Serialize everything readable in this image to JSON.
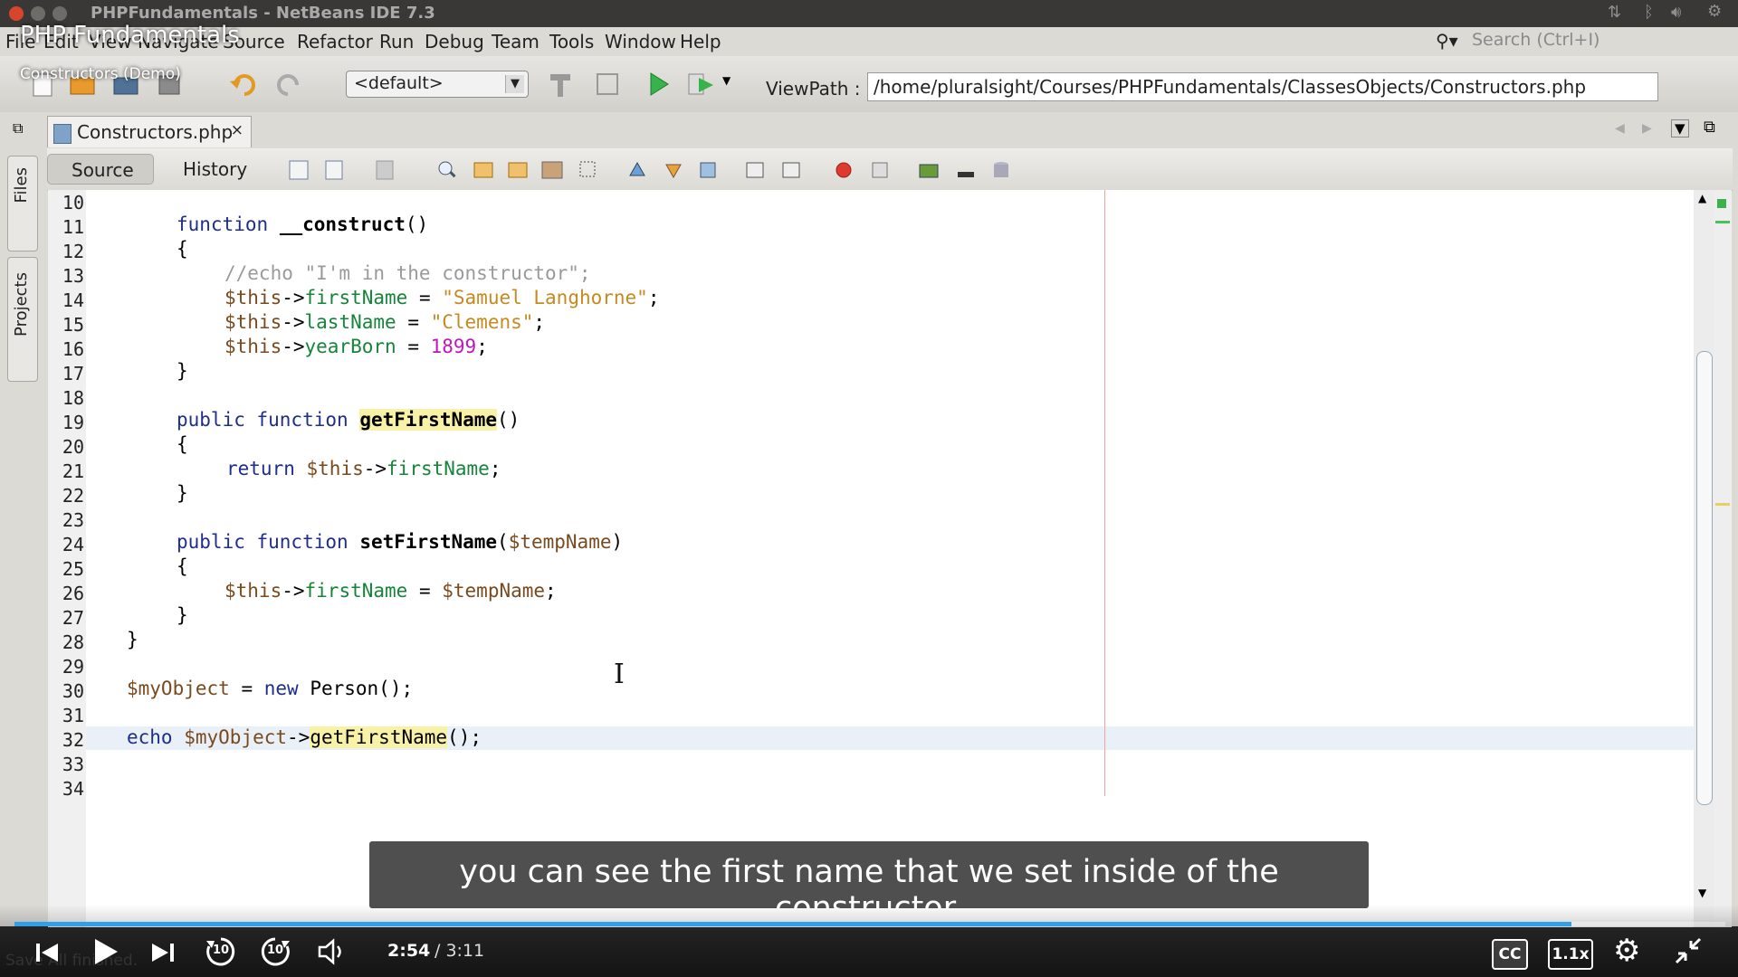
{
  "window": {
    "title": "PHPFundamentals - NetBeans IDE 7.3"
  },
  "menu": {
    "items": [
      "File",
      "Edit",
      "View",
      "Navigate",
      "Source",
      "Refactor",
      "Run",
      "Debug",
      "Team",
      "Tools",
      "Window",
      "Help"
    ],
    "search_placeholder": "Search (Ctrl+I)"
  },
  "toolbar": {
    "config_value": "<default>",
    "viewpath_label": "ViewPath :",
    "viewpath_value": "/home/pluralsight/Courses/PHPFundamentals/ClassesObjects/Constructors.php"
  },
  "sidebar": {
    "tabs": [
      "Files",
      "Projects"
    ]
  },
  "editor": {
    "file_tab": "Constructors.php",
    "close_glyph": "×",
    "view_tabs": [
      "Source",
      "History"
    ],
    "line_numbers": [
      "10",
      "11",
      "12",
      "13",
      "14",
      "15",
      "16",
      "17",
      "18",
      "19",
      "20",
      "21",
      "22",
      "23",
      "24",
      "25",
      "26",
      "27",
      "28",
      "29",
      "30",
      "31",
      "32",
      "33",
      "34"
    ],
    "code": {
      "l11_kw": "function",
      "l11_fn": "__construct",
      "l11_rest": "()",
      "brace_open": "{",
      "brace_close": "}",
      "l13": "//echo \"I'm in the constructor\";",
      "this": "$this",
      "arrow": "->",
      "l14_prop": "firstName",
      "l14_str": "\"Samuel Langhorne\"",
      "l15_prop": "lastName",
      "l15_str": "\"Clemens\"",
      "l16_prop": "yearBorn",
      "l16_num": "1899",
      "assign": " = ",
      "semi": ";",
      "l19_kw": "public function",
      "l19_fn": "getFirstName",
      "parens": "()",
      "l21_kw": "return",
      "l21_prop": "firstName",
      "l24_fn": "setFirstName",
      "l24_arg": "$tempName",
      "l26_prop": "firstName",
      "l26_var": "$tempName",
      "l30_var": "$myObject",
      "l30_kw": "new",
      "l30_cls": "Person();",
      "l32_kw": "echo",
      "l32_var": "$myObject",
      "l32_fn": "getFirstName",
      "l32_end": "();"
    }
  },
  "overlay": {
    "course_title": "PHP Fundamentals",
    "module_title": "Constructors (Demo)",
    "caption": "you can see the first name that we set inside of the constructor.",
    "status_text": "Save All finished."
  },
  "player": {
    "time_current": "2:54",
    "time_total": "/ 3:11",
    "progress_fraction": 0.91,
    "skip_back": "10",
    "skip_forward": "10",
    "cc_label": "CC",
    "speed_label": "1.1x"
  },
  "colors": {
    "accent": "#31a0e8",
    "keyword": "#1d2e8c",
    "property": "#16853a",
    "string": "#c8891e",
    "number": "#c116b9"
  }
}
